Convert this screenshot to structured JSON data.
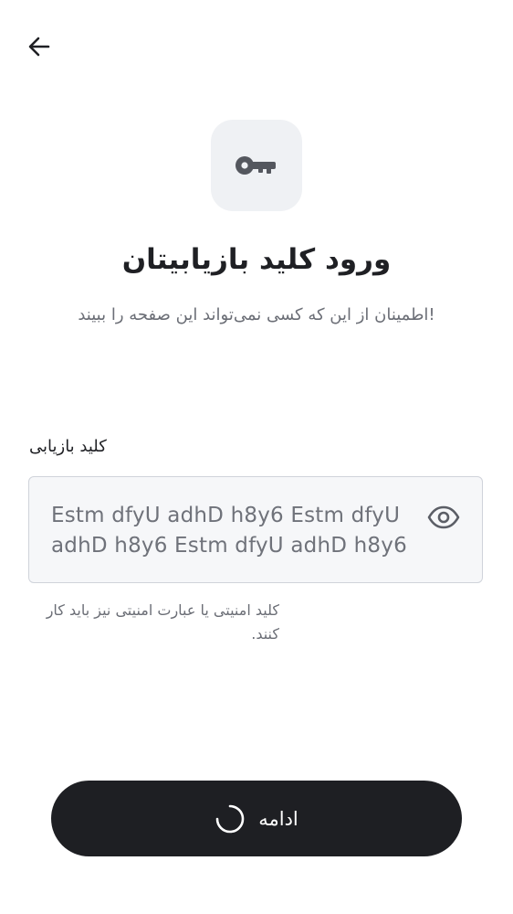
{
  "header": {
    "back_icon": "arrow-left-icon"
  },
  "hero": {
    "icon": "key-icon",
    "title": "ورود کلید بازیابیتان",
    "subtitle": "!اطمینان از این که کسی نمی‌تواند این صفحه را ببیند"
  },
  "form": {
    "label": "کلید بازیابی",
    "value": "Estm dfyU adhD h8y6 Estm dfyU adhD h8y6 Estm dfyU adhD h8y6",
    "toggle_icon": "eye-icon",
    "helper": "کلید امنیتی یا عبارت امنیتی نیز باید کار کنند."
  },
  "footer": {
    "continue_label": "ادامه",
    "loading_icon": "spinner-icon"
  },
  "colors": {
    "primary": "#1e1f23",
    "badge_bg": "#eff1f4",
    "muted_text": "#6b6e76",
    "input_bg": "#f6f7f9",
    "input_border": "#cfd3da"
  }
}
